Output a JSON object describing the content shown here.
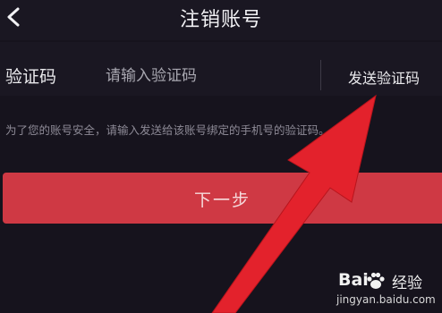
{
  "header": {
    "title": "注销账号",
    "back_icon": "chevron-left-icon"
  },
  "form": {
    "code_label": "验证码",
    "code_placeholder": "请输入验证码",
    "send_code_label": "发送验证码",
    "hint": "为了您的账号安全，请输入发送给该账号绑定的手机号的验证码。"
  },
  "next_button": {
    "label": "下一步"
  },
  "annotation": {
    "arrow_color": "#e3222c",
    "arrow_icon": "red-arrow-icon"
  },
  "watermark": {
    "brand": "Bai",
    "suffix": "经验",
    "url": "jingyan.baidu.com"
  },
  "colors": {
    "background": "#16131d",
    "primary_button": "#cf3944",
    "hint_text": "#8d8a96"
  }
}
